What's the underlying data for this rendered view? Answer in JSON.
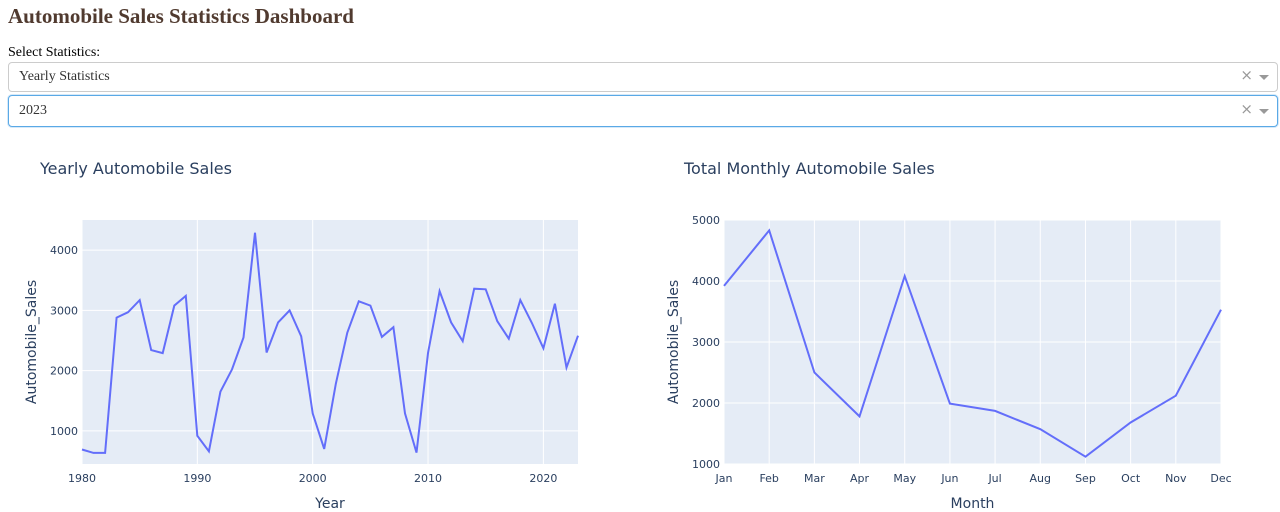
{
  "header": {
    "title": "Automobile Sales Statistics Dashboard"
  },
  "controls": {
    "select_label": "Select Statistics:",
    "statistics_dropdown": {
      "value": "Yearly Statistics",
      "clear_glyph": "×"
    },
    "year_dropdown": {
      "value": "2023",
      "clear_glyph": "×"
    }
  },
  "colors": {
    "line": "#636EFA",
    "plot_bg": "#E5ECF6",
    "grid": "#ffffff",
    "text": "#2a3f5f",
    "title": "#503A2F"
  },
  "chart_data": [
    {
      "type": "line",
      "title": "Yearly Automobile Sales",
      "xlabel": "Year",
      "ylabel": "Automobile_Sales",
      "xlim": [
        1980,
        2023
      ],
      "ylim": [
        450,
        4500
      ],
      "xticks": [
        1980,
        1990,
        2000,
        2010,
        2020
      ],
      "yticks": [
        1000,
        2000,
        3000,
        4000
      ],
      "x": [
        1980,
        1981,
        1982,
        1983,
        1984,
        1985,
        1986,
        1987,
        1988,
        1989,
        1990,
        1991,
        1992,
        1993,
        1994,
        1995,
        1996,
        1997,
        1998,
        1999,
        2000,
        2001,
        2002,
        2003,
        2004,
        2005,
        2006,
        2007,
        2008,
        2009,
        2010,
        2011,
        2012,
        2013,
        2014,
        2015,
        2016,
        2017,
        2018,
        2019,
        2020,
        2021,
        2022,
        2023
      ],
      "values": [
        690,
        635,
        635,
        2880,
        2970,
        3170,
        2340,
        2290,
        3080,
        3240,
        920,
        660,
        1650,
        2020,
        2550,
        4290,
        2300,
        2800,
        3000,
        2570,
        1290,
        700,
        1780,
        2630,
        3150,
        3080,
        2560,
        2720,
        1290,
        640,
        2290,
        3320,
        2800,
        2490,
        3360,
        3350,
        2820,
        2530,
        3170,
        2790,
        2370,
        3110,
        2050,
        2580
      ],
      "grid": true
    },
    {
      "type": "line",
      "title": "Total Monthly Automobile Sales",
      "xlabel": "Month",
      "ylabel": "Automobile_Sales",
      "categories": [
        "Jan",
        "Feb",
        "Mar",
        "Apr",
        "May",
        "Jun",
        "Jul",
        "Aug",
        "Sep",
        "Oct",
        "Nov",
        "Dec"
      ],
      "ylim": [
        1000,
        5000
      ],
      "yticks": [
        1000,
        2000,
        3000,
        4000,
        5000
      ],
      "values": [
        3920,
        4830,
        2500,
        1780,
        4080,
        1990,
        1870,
        1570,
        1120,
        1680,
        2120,
        3530
      ],
      "grid": true
    }
  ]
}
